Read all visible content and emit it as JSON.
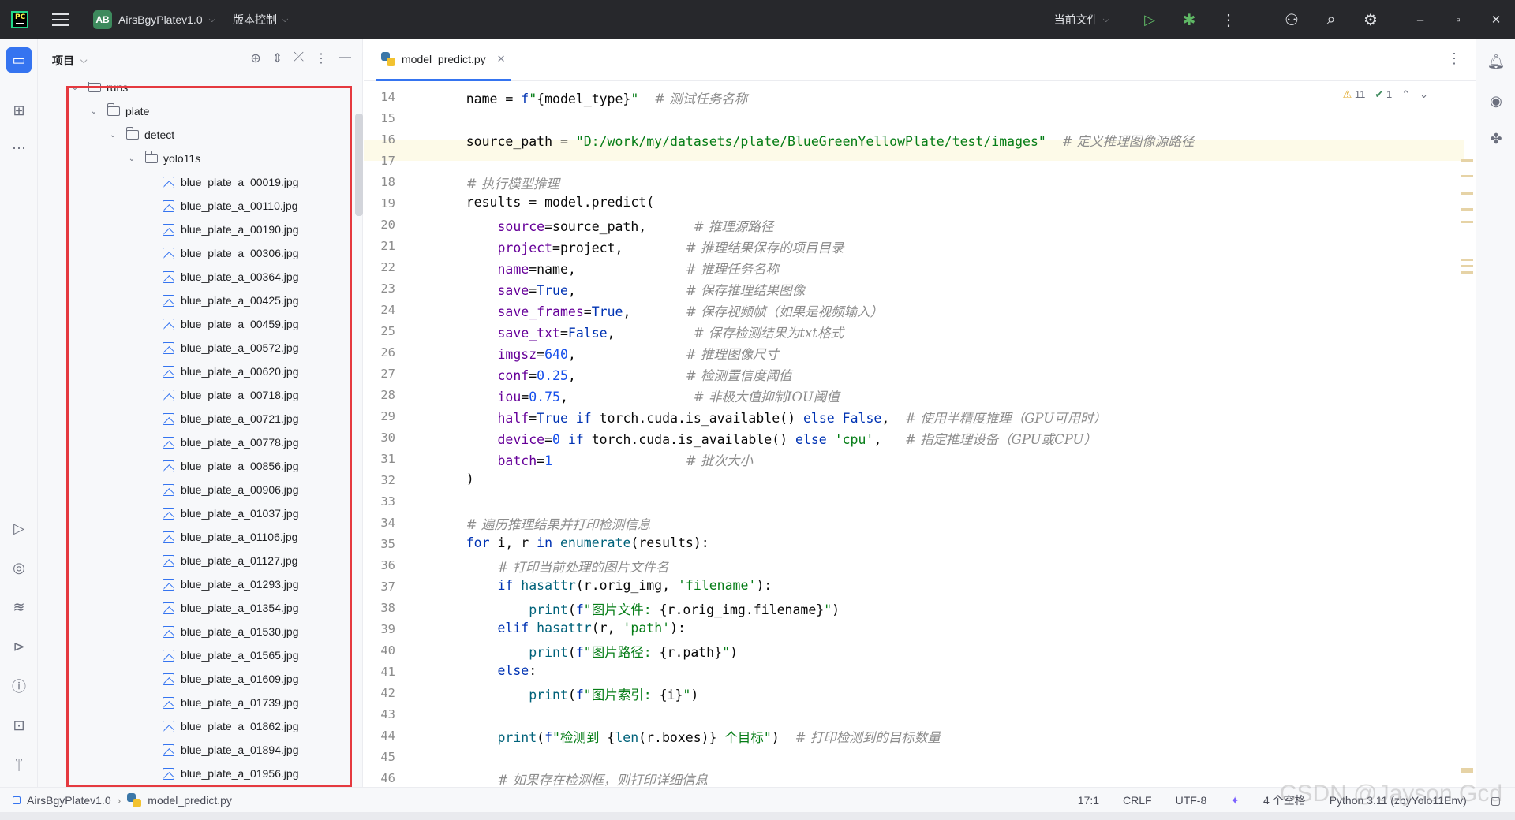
{
  "titlebar": {
    "badge": "AB",
    "project_name": "AirsBgyPlatev1.0",
    "vcs_label": "版本控制",
    "run_config": "当前文件"
  },
  "project_panel": {
    "title": "项目",
    "tree": [
      {
        "label": "runs",
        "depth": 0,
        "type": "folder",
        "expanded": true
      },
      {
        "label": "plate",
        "depth": 1,
        "type": "folder",
        "expanded": true
      },
      {
        "label": "detect",
        "depth": 2,
        "type": "folder",
        "expanded": true
      },
      {
        "label": "yolo11s",
        "depth": 3,
        "type": "folder",
        "expanded": true
      },
      {
        "label": "blue_plate_a_00019.jpg",
        "depth": 4,
        "type": "image"
      },
      {
        "label": "blue_plate_a_00110.jpg",
        "depth": 4,
        "type": "image"
      },
      {
        "label": "blue_plate_a_00190.jpg",
        "depth": 4,
        "type": "image"
      },
      {
        "label": "blue_plate_a_00306.jpg",
        "depth": 4,
        "type": "image"
      },
      {
        "label": "blue_plate_a_00364.jpg",
        "depth": 4,
        "type": "image"
      },
      {
        "label": "blue_plate_a_00425.jpg",
        "depth": 4,
        "type": "image"
      },
      {
        "label": "blue_plate_a_00459.jpg",
        "depth": 4,
        "type": "image"
      },
      {
        "label": "blue_plate_a_00572.jpg",
        "depth": 4,
        "type": "image"
      },
      {
        "label": "blue_plate_a_00620.jpg",
        "depth": 4,
        "type": "image"
      },
      {
        "label": "blue_plate_a_00718.jpg",
        "depth": 4,
        "type": "image"
      },
      {
        "label": "blue_plate_a_00721.jpg",
        "depth": 4,
        "type": "image"
      },
      {
        "label": "blue_plate_a_00778.jpg",
        "depth": 4,
        "type": "image"
      },
      {
        "label": "blue_plate_a_00856.jpg",
        "depth": 4,
        "type": "image"
      },
      {
        "label": "blue_plate_a_00906.jpg",
        "depth": 4,
        "type": "image"
      },
      {
        "label": "blue_plate_a_01037.jpg",
        "depth": 4,
        "type": "image"
      },
      {
        "label": "blue_plate_a_01106.jpg",
        "depth": 4,
        "type": "image"
      },
      {
        "label": "blue_plate_a_01127.jpg",
        "depth": 4,
        "type": "image"
      },
      {
        "label": "blue_plate_a_01293.jpg",
        "depth": 4,
        "type": "image"
      },
      {
        "label": "blue_plate_a_01354.jpg",
        "depth": 4,
        "type": "image"
      },
      {
        "label": "blue_plate_a_01530.jpg",
        "depth": 4,
        "type": "image"
      },
      {
        "label": "blue_plate_a_01565.jpg",
        "depth": 4,
        "type": "image"
      },
      {
        "label": "blue_plate_a_01609.jpg",
        "depth": 4,
        "type": "image"
      },
      {
        "label": "blue_plate_a_01739.jpg",
        "depth": 4,
        "type": "image"
      },
      {
        "label": "blue_plate_a_01862.jpg",
        "depth": 4,
        "type": "image"
      },
      {
        "label": "blue_plate_a_01894.jpg",
        "depth": 4,
        "type": "image"
      },
      {
        "label": "blue_plate_a_01956.jpg",
        "depth": 4,
        "type": "image"
      }
    ]
  },
  "editor": {
    "tab_label": "model_predict.py",
    "inspections": {
      "warnings": "11",
      "ok": "1"
    },
    "lines": [
      {
        "n": "14",
        "tokens": [
          [
            "",
            "    name = "
          ],
          [
            "kw",
            "f"
          ],
          [
            "str",
            "\""
          ],
          [
            "",
            "{model_type}"
          ],
          [
            "str",
            "\""
          ],
          [
            "",
            "  "
          ],
          [
            "cm",
            "# 测试任务名称"
          ]
        ]
      },
      {
        "n": "15",
        "tokens": []
      },
      {
        "n": "16",
        "tokens": [
          [
            "",
            "    source_path = "
          ],
          [
            "str",
            "\"D:/work/my/datasets/plate/BlueGreenYellowPlate/test/images\""
          ],
          [
            "",
            "  "
          ],
          [
            "cm",
            "# 定义推理图像源路径"
          ]
        ]
      },
      {
        "n": "17",
        "tokens": []
      },
      {
        "n": "18",
        "tokens": [
          [
            "",
            "    "
          ],
          [
            "cm",
            "# 执行模型推理"
          ]
        ]
      },
      {
        "n": "19",
        "tokens": [
          [
            "",
            "    results = model.predict("
          ]
        ]
      },
      {
        "n": "20",
        "tokens": [
          [
            "",
            "        "
          ],
          [
            "par",
            "source"
          ],
          [
            "",
            "=source_path,      "
          ],
          [
            "cm",
            "# 推理源路径"
          ]
        ]
      },
      {
        "n": "21",
        "tokens": [
          [
            "",
            "        "
          ],
          [
            "par",
            "project"
          ],
          [
            "",
            "=project,        "
          ],
          [
            "cm",
            "# 推理结果保存的项目目录"
          ]
        ]
      },
      {
        "n": "22",
        "tokens": [
          [
            "",
            "        "
          ],
          [
            "par",
            "name"
          ],
          [
            "",
            "=name,              "
          ],
          [
            "cm",
            "# 推理任务名称"
          ]
        ]
      },
      {
        "n": "23",
        "tokens": [
          [
            "",
            "        "
          ],
          [
            "par",
            "save"
          ],
          [
            "",
            "="
          ],
          [
            "kw",
            "True"
          ],
          [
            "",
            ",              "
          ],
          [
            "cm",
            "# 保存推理结果图像"
          ]
        ]
      },
      {
        "n": "24",
        "tokens": [
          [
            "",
            "        "
          ],
          [
            "par",
            "save_frames"
          ],
          [
            "",
            "="
          ],
          [
            "kw",
            "True"
          ],
          [
            "",
            ",       "
          ],
          [
            "cm",
            "# 保存视频帧（如果是视频输入）"
          ]
        ]
      },
      {
        "n": "25",
        "tokens": [
          [
            "",
            "        "
          ],
          [
            "par",
            "save_txt"
          ],
          [
            "",
            "="
          ],
          [
            "kw",
            "False"
          ],
          [
            "",
            ",          "
          ],
          [
            "cm",
            "# 保存检测结果为txt格式"
          ]
        ]
      },
      {
        "n": "26",
        "tokens": [
          [
            "",
            "        "
          ],
          [
            "par",
            "imgsz"
          ],
          [
            "",
            "="
          ],
          [
            "num",
            "640"
          ],
          [
            "",
            ",              "
          ],
          [
            "cm",
            "# 推理图像尺寸"
          ]
        ]
      },
      {
        "n": "27",
        "tokens": [
          [
            "",
            "        "
          ],
          [
            "par",
            "conf"
          ],
          [
            "",
            "="
          ],
          [
            "num",
            "0.25"
          ],
          [
            "",
            ",              "
          ],
          [
            "cm",
            "# 检测置信度阈值"
          ]
        ]
      },
      {
        "n": "28",
        "tokens": [
          [
            "",
            "        "
          ],
          [
            "par",
            "iou"
          ],
          [
            "",
            "="
          ],
          [
            "num",
            "0.75"
          ],
          [
            "",
            ",                "
          ],
          [
            "cm",
            "# 非极大值抑制IOU阈值"
          ]
        ]
      },
      {
        "n": "29",
        "tokens": [
          [
            "",
            "        "
          ],
          [
            "par",
            "half"
          ],
          [
            "",
            "="
          ],
          [
            "kw",
            "True"
          ],
          [
            "",
            " "
          ],
          [
            "kw",
            "if"
          ],
          [
            "",
            " torch.cuda.is_available() "
          ],
          [
            "kw",
            "else"
          ],
          [
            "",
            " "
          ],
          [
            "kw",
            "False"
          ],
          [
            "",
            ",  "
          ],
          [
            "cm",
            "# 使用半精度推理（GPU可用时）"
          ]
        ]
      },
      {
        "n": "30",
        "tokens": [
          [
            "",
            "        "
          ],
          [
            "par",
            "device"
          ],
          [
            "",
            "="
          ],
          [
            "num",
            "0"
          ],
          [
            "",
            " "
          ],
          [
            "kw",
            "if"
          ],
          [
            "",
            " torch.cuda.is_available() "
          ],
          [
            "kw",
            "else"
          ],
          [
            "",
            " "
          ],
          [
            "str",
            "'cpu'"
          ],
          [
            "",
            ",   "
          ],
          [
            "cm",
            "# 指定推理设备（GPU或CPU）"
          ]
        ]
      },
      {
        "n": "31",
        "tokens": [
          [
            "",
            "        "
          ],
          [
            "par",
            "batch"
          ],
          [
            "",
            "="
          ],
          [
            "num",
            "1"
          ],
          [
            "",
            "                 "
          ],
          [
            "cm",
            "# 批次大小"
          ]
        ]
      },
      {
        "n": "32",
        "tokens": [
          [
            "",
            "    )"
          ]
        ]
      },
      {
        "n": "33",
        "tokens": []
      },
      {
        "n": "34",
        "tokens": [
          [
            "",
            "    "
          ],
          [
            "cm",
            "# 遍历推理结果并打印检测信息"
          ]
        ]
      },
      {
        "n": "35",
        "tokens": [
          [
            "",
            "    "
          ],
          [
            "kw",
            "for"
          ],
          [
            "",
            " i, r "
          ],
          [
            "kw",
            "in"
          ],
          [
            "",
            " "
          ],
          [
            "fn",
            "enumerate"
          ],
          [
            "",
            "(results):"
          ]
        ]
      },
      {
        "n": "36",
        "tokens": [
          [
            "",
            "        "
          ],
          [
            "cm",
            "# 打印当前处理的图片文件名"
          ]
        ]
      },
      {
        "n": "37",
        "tokens": [
          [
            "",
            "        "
          ],
          [
            "kw",
            "if"
          ],
          [
            "",
            " "
          ],
          [
            "fn",
            "hasattr"
          ],
          [
            "",
            "(r.orig_img, "
          ],
          [
            "str",
            "'filename'"
          ],
          [
            "",
            "):"
          ]
        ]
      },
      {
        "n": "38",
        "tokens": [
          [
            "",
            "            "
          ],
          [
            "fn",
            "print"
          ],
          [
            "",
            "("
          ],
          [
            "kw",
            "f"
          ],
          [
            "str",
            "\"图片文件: "
          ],
          [
            "",
            "{r.orig_img.filename}"
          ],
          [
            "str",
            "\""
          ],
          [
            "",
            ")"
          ]
        ]
      },
      {
        "n": "39",
        "tokens": [
          [
            "",
            "        "
          ],
          [
            "kw",
            "elif"
          ],
          [
            "",
            " "
          ],
          [
            "fn",
            "hasattr"
          ],
          [
            "",
            "(r, "
          ],
          [
            "str",
            "'path'"
          ],
          [
            "",
            "):"
          ]
        ]
      },
      {
        "n": "40",
        "tokens": [
          [
            "",
            "            "
          ],
          [
            "fn",
            "print"
          ],
          [
            "",
            "("
          ],
          [
            "kw",
            "f"
          ],
          [
            "str",
            "\"图片路径: "
          ],
          [
            "",
            "{r.path}"
          ],
          [
            "str",
            "\""
          ],
          [
            "",
            ")"
          ]
        ]
      },
      {
        "n": "41",
        "tokens": [
          [
            "",
            "        "
          ],
          [
            "kw",
            "else"
          ],
          [
            "",
            ":"
          ]
        ]
      },
      {
        "n": "42",
        "tokens": [
          [
            "",
            "            "
          ],
          [
            "fn",
            "print"
          ],
          [
            "",
            "("
          ],
          [
            "kw",
            "f"
          ],
          [
            "str",
            "\"图片索引: "
          ],
          [
            "",
            "{i}"
          ],
          [
            "str",
            "\""
          ],
          [
            "",
            ")"
          ]
        ]
      },
      {
        "n": "43",
        "tokens": []
      },
      {
        "n": "44",
        "tokens": [
          [
            "",
            "        "
          ],
          [
            "fn",
            "print"
          ],
          [
            "",
            "("
          ],
          [
            "kw",
            "f"
          ],
          [
            "str",
            "\"检测到 "
          ],
          [
            "",
            "{"
          ],
          [
            "fn",
            "len"
          ],
          [
            "",
            "(r.boxes)}"
          ],
          [
            "str",
            " 个目标\""
          ],
          [
            "",
            ")  "
          ],
          [
            "cm",
            "# 打印检测到的目标数量"
          ]
        ]
      },
      {
        "n": "45",
        "tokens": []
      },
      {
        "n": "46",
        "tokens": [
          [
            "",
            "        "
          ],
          [
            "cm",
            "# 如果存在检测框，则打印详细信息"
          ]
        ]
      }
    ]
  },
  "statusbar": {
    "breadcrumb_project": "AirsBgyPlatev1.0",
    "breadcrumb_file": "model_predict.py",
    "position": "17:1",
    "line_sep": "CRLF",
    "encoding": "UTF-8",
    "indent": "4 个空格",
    "interpreter": "Python 3.11 (zbyYolo11Env)"
  },
  "watermark": "CSDN @Jayson Gcd"
}
